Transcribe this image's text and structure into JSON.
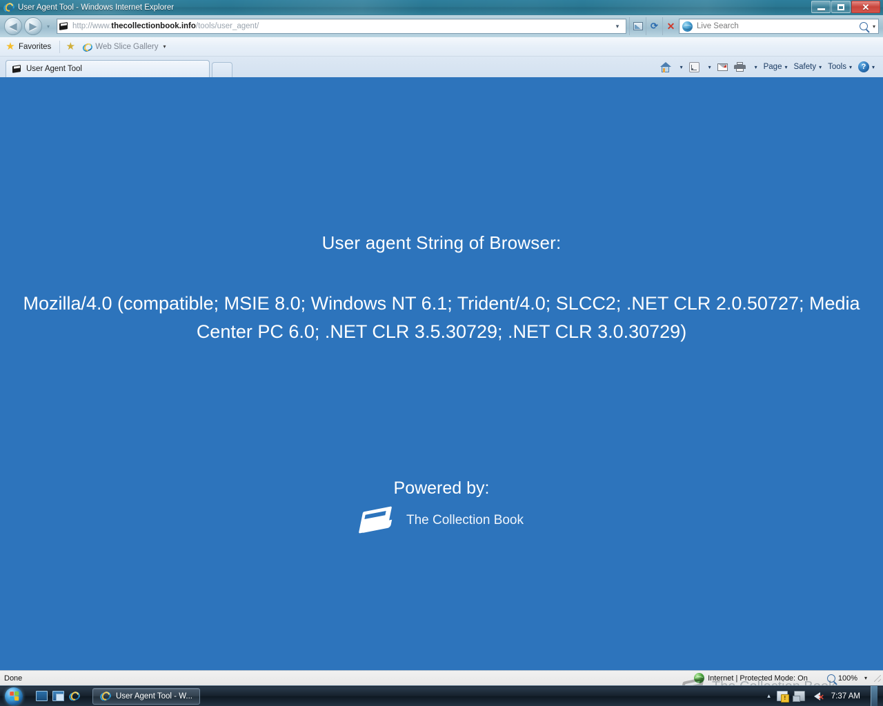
{
  "window": {
    "title": "User Agent Tool - Windows Internet Explorer",
    "app_icon": "internet-explorer-icon",
    "minimize_label": "Minimize",
    "maximize_label": "Maximize",
    "close_label": "Close"
  },
  "navigation": {
    "back_label": "Back",
    "forward_label": "Forward",
    "history_dropdown": "▾",
    "url": {
      "protocol": "http://www.",
      "domain": "thecollectionbook.info",
      "path": "/tools/user_agent/",
      "full": "http://www.thecollectionbook.info/tools/user_agent/"
    },
    "address_dropdown": "▾",
    "compatibility_label": "Compatibility View",
    "refresh_label": "Refresh",
    "stop_label": "Stop"
  },
  "search": {
    "provider_icon": "live-search-globe-icon",
    "placeholder": "Live Search",
    "go_label": "Search",
    "dropdown": "▾"
  },
  "favorites_bar": {
    "favorites_label": "Favorites",
    "web_slice_label": "Web Slice Gallery",
    "dropdown_caret": "▾"
  },
  "tabs": [
    {
      "label": "User Agent Tool",
      "icon": "book-favicon",
      "active": true
    }
  ],
  "new_tab_label": "New Tab",
  "command_bar": [
    {
      "name": "home",
      "label": "",
      "icon": "home-icon",
      "has_dropdown": true
    },
    {
      "name": "feeds",
      "label": "",
      "icon": "rss-icon",
      "has_dropdown": true
    },
    {
      "name": "read-mail",
      "label": "",
      "icon": "mail-icon",
      "has_dropdown": false
    },
    {
      "name": "print",
      "label": "",
      "icon": "printer-icon",
      "has_dropdown": true
    },
    {
      "name": "page",
      "label": "Page",
      "icon": "",
      "has_dropdown": true
    },
    {
      "name": "safety",
      "label": "Safety",
      "icon": "",
      "has_dropdown": true
    },
    {
      "name": "tools",
      "label": "Tools",
      "icon": "",
      "has_dropdown": true
    },
    {
      "name": "help",
      "label": "",
      "icon": "help-icon",
      "has_dropdown": true
    }
  ],
  "page": {
    "background_color": "#2d74bc",
    "heading": "User agent String of Browser:",
    "user_agent_string": "Mozilla/4.0 (compatible; MSIE 8.0; Windows NT 6.1; Trident/4.0; SLCC2; .NET CLR 2.0.50727; Media Center PC 6.0; .NET CLR 3.5.30729; .NET CLR 3.0.30729)",
    "powered_by_label": "Powered by:",
    "brand_name": "The Collection Book",
    "brand_icon": "book-logo-icon"
  },
  "status_bar": {
    "status_text": "Done",
    "zone_icon": "internet-zone-globe-icon",
    "zone_text": "Internet | Protected Mode: On",
    "zoom_icon": "zoom-magnifier-icon",
    "zoom_level": "100%",
    "zoom_dropdown": "▾"
  },
  "watermark": {
    "text": "The Collection Book",
    "icon": "book-watermark-icon"
  },
  "taskbar": {
    "start_label": "Start",
    "quick_launch": [
      {
        "name": "show-desktop",
        "label": "Show desktop"
      },
      {
        "name": "switch-windows",
        "label": "Switch between windows"
      },
      {
        "name": "internet-explorer",
        "label": "Launch Internet Explorer Browser"
      }
    ],
    "buttons": [
      {
        "name": "internet-explorer-window",
        "label": "User Agent Tool - W...",
        "icon": "internet-explorer-icon",
        "active": true
      }
    ],
    "tray": {
      "show_hidden_caret": "▴",
      "icons": [
        {
          "name": "action-center-flag",
          "label": "Action Center"
        },
        {
          "name": "network",
          "label": "Network"
        },
        {
          "name": "volume-muted",
          "label": "Volume muted"
        }
      ],
      "clock": "7:37 AM"
    }
  }
}
